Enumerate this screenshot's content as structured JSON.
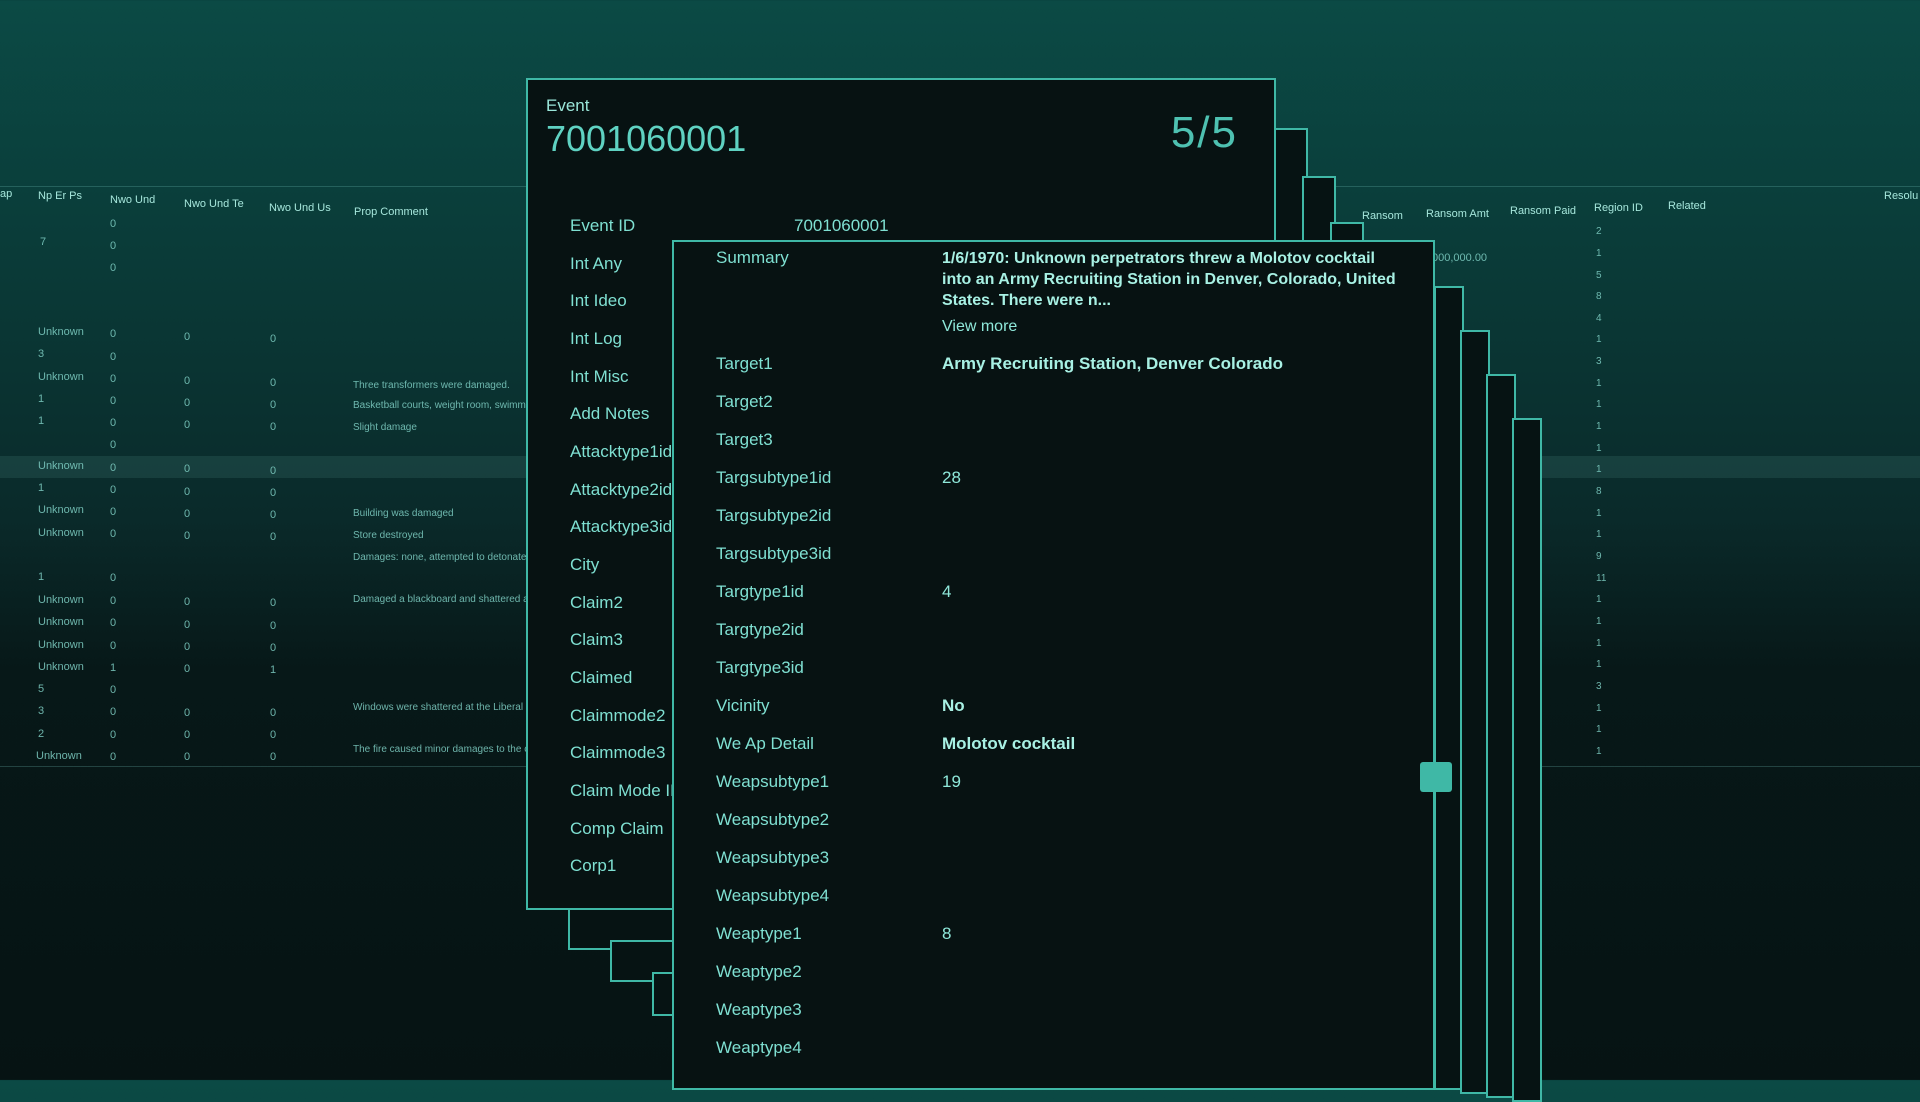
{
  "background_table": {
    "left_headers": [
      "ap",
      "Np Er Ps",
      "Nwo Und",
      "Nwo Und Te",
      "Nwo Und Us",
      "Prop Comment"
    ],
    "right_headers": [
      "Ransom",
      "Ransom Amt",
      "Ransom Paid",
      "Region ID",
      "Related",
      "Resolu"
    ],
    "ransom_amt_value": "000,000.00",
    "np_er_ps": [
      "7",
      "Unknown",
      "3",
      "Unknown",
      "1",
      "1",
      "Unknown",
      "1",
      "Unknown",
      "Unknown",
      "1",
      "Unknown",
      "Unknown",
      "Unknown",
      "Unknown",
      "5",
      "3",
      "2",
      "Unknown"
    ],
    "nwo_und": [
      "0",
      "0",
      "0",
      "0",
      "0",
      "0",
      "0",
      "0",
      "0",
      "0",
      "0",
      "0",
      "0",
      "0",
      "0",
      "0",
      "0",
      "1",
      "0",
      "0",
      "0",
      "0"
    ],
    "nwo_und_te": [
      "0",
      "0",
      "0",
      "0",
      "0",
      "0",
      "0",
      "0",
      "0",
      "0",
      "0",
      "0",
      "0",
      "0",
      "0",
      "0"
    ],
    "nwo_und_us": [
      "0",
      "0",
      "0",
      "0",
      "0",
      "0",
      "0",
      "0",
      "0",
      "0",
      "0",
      "1",
      "0",
      "0",
      "0"
    ],
    "prop_comments": [
      "Three transformers were damaged.",
      "Basketball courts, weight room, swimm",
      "Slight damage",
      "Building was damaged",
      "Store destroyed",
      "Damages: none, attempted to detonate",
      "Damaged a blackboard and shattered a",
      "Windows were shattered at the Liberal",
      "The fire caused minor damages to the c"
    ],
    "region_ids": [
      "2",
      "1",
      "5",
      "8",
      "4",
      "1",
      "3",
      "1",
      "1",
      "1",
      "1",
      "1",
      "8",
      "1",
      "1",
      "9",
      "11",
      "1",
      "1",
      "1",
      "1",
      "3",
      "1",
      "1",
      "1"
    ]
  },
  "back_card": {
    "label": "Event",
    "event_id": "7001060001",
    "count": "5/5",
    "fields": [
      "Event ID",
      "Int Any",
      "Int Ideo",
      "Int Log",
      "Int Misc",
      "Add Notes",
      "Attacktype1id",
      "Attacktype2id",
      "Attacktype3id",
      "City",
      "Claim2",
      "Claim3",
      "Claimed",
      "Claimmode2",
      "Claimmode3",
      "Claim Mode ID",
      "Comp Claim",
      "Corp1"
    ],
    "event_id_value": "7001060001"
  },
  "front_card": {
    "summary_label": "Summary",
    "summary_text": "1/6/1970: Unknown perpetrators threw a Molotov cocktail into an Army Recruiting Station in Denver, Colorado, United States. There were n...",
    "view_more": "View more",
    "rows": [
      {
        "label": "Target1",
        "value": "Army Recruiting Station, Denver Colorado",
        "bold": true
      },
      {
        "label": "Target2",
        "value": ""
      },
      {
        "label": "Target3",
        "value": ""
      },
      {
        "label": "Targsubtype1id",
        "value": "28"
      },
      {
        "label": "Targsubtype2id",
        "value": ""
      },
      {
        "label": "Targsubtype3id",
        "value": ""
      },
      {
        "label": "Targtype1id",
        "value": "4"
      },
      {
        "label": "Targtype2id",
        "value": ""
      },
      {
        "label": "Targtype3id",
        "value": ""
      },
      {
        "label": "Vicinity",
        "value": "No",
        "bold": true
      },
      {
        "label": "We Ap Detail",
        "value": "Molotov cocktail",
        "bold": true
      },
      {
        "label": "Weapsubtype1",
        "value": "19"
      },
      {
        "label": "Weapsubtype2",
        "value": ""
      },
      {
        "label": "Weapsubtype3",
        "value": ""
      },
      {
        "label": "Weapsubtype4",
        "value": ""
      },
      {
        "label": "Weaptype1",
        "value": "8"
      },
      {
        "label": "Weaptype2",
        "value": ""
      },
      {
        "label": "Weaptype3",
        "value": ""
      },
      {
        "label": "Weaptype4",
        "value": ""
      }
    ]
  }
}
